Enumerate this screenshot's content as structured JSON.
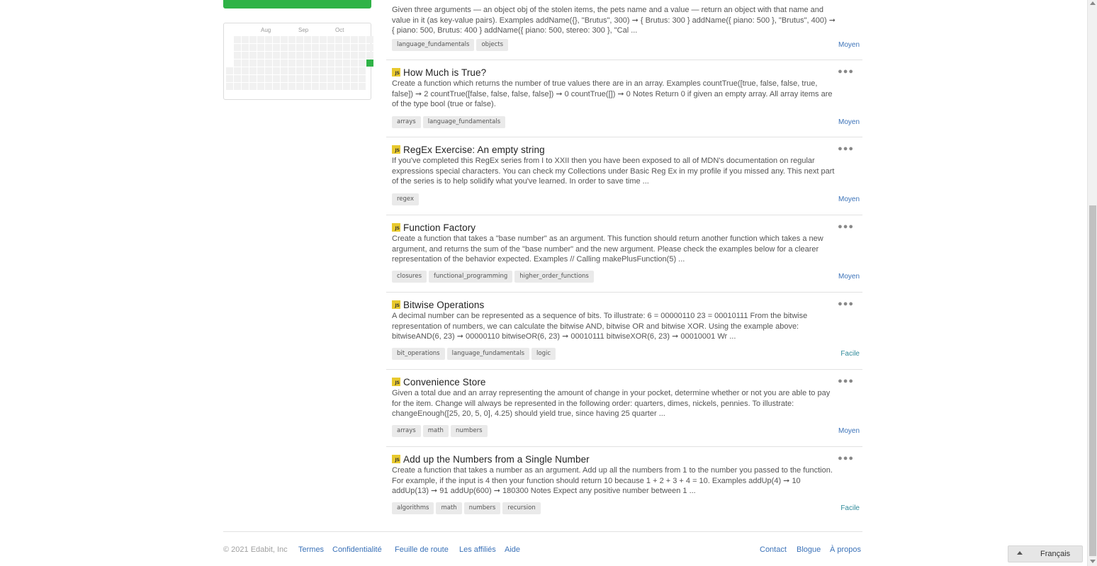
{
  "sidebar": {
    "heatmap": {
      "months": [
        "Aug",
        "Sep",
        "Oct"
      ],
      "colors": {
        "empty": "#f1f1f1",
        "active": "#2fb347"
      }
    }
  },
  "challenges": [
    {
      "title": "",
      "description": "Given three arguments — an object obj of the stolen items, the pets name and a value — return an object with that name and value in it (as key-value pairs). Examples addName({}, \"Brutus\", 300) ➞ { Brutus: 300 } addName({ piano: 500 }, \"Brutus\", 400) ➞ { piano: 500, Brutus: 400 } addName({ piano: 500, stereo: 300 }, \"Cal ...",
      "tags": [
        "language_fundamentals",
        "objects"
      ],
      "level": "Moyen"
    },
    {
      "title": "How Much is True?",
      "description": "Create a function which returns the number of true values there are in an array. Examples countTrue([true, false, false, true, false]) ➞ 2 countTrue([false, false, false, false]) ➞ 0 countTrue([]) ➞ 0 Notes Return 0 if given an empty array. All array items are of the type bool (true or false).",
      "tags": [
        "arrays",
        "language_fundamentals"
      ],
      "level": "Moyen"
    },
    {
      "title": "RegEx Exercise: An empty string",
      "description": "If you've completed this RegEx series from I to XXII then you have been exposed to all of MDN's documentation on regular expressions special characters. You can check my Collections under Basic Reg Ex in my profile if you missed any. This next part of the series is to help solidify what you've learned. In order to save time ...",
      "tags": [
        "regex"
      ],
      "level": "Moyen"
    },
    {
      "title": "Function Factory",
      "description": "Create a function that takes a \"base number\" as an argument. This function should return another function which takes a new argument, and returns the sum of the \"base number\" and the new argument. Please check the examples below for a clearer representation of the behavior expected. Examples // Calling makePlusFunction(5) ...",
      "tags": [
        "closures",
        "functional_programming",
        "higher_order_functions"
      ],
      "level": "Moyen"
    },
    {
      "title": "Bitwise Operations",
      "description": "A decimal number can be represented as a sequence of bits. To illustrate: 6 = 00000110 23 = 00010111 From the bitwise representation of numbers, we can calculate the bitwise AND, bitwise OR and bitwise XOR. Using the example above: bitwiseAND(6, 23) ➞ 00000110 bitwiseOR(6, 23) ➞ 00010111 bitwiseXOR(6, 23) ➞ 00010001 Wr ...",
      "tags": [
        "bit_operations",
        "language_fundamentals",
        "logic"
      ],
      "level": "Facile"
    },
    {
      "title": "Convenience Store",
      "description": "Given a total due and an array representing the amount of change in your pocket, determine whether or not you are able to pay for the item. Change will always be represented in the following order: quarters, dimes, nickels, pennies. To illustrate: changeEnough([25, 20, 5, 0], 4.25) should yield true, since having 25 quarter ...",
      "tags": [
        "arrays",
        "math",
        "numbers"
      ],
      "level": "Moyen"
    },
    {
      "title": "Add up the Numbers from a Single Number",
      "description": "Create a function that takes a number as an argument. Add up all the numbers from 1 to the number you passed to the function. For example, if the input is 4 then your function should return 10 because 1 + 2 + 3 + 4 = 10. Examples addUp(4) ➞ 10 addUp(13) ➞ 91 addUp(600) ➞ 180300 Notes Expect any positive number between 1 ...",
      "tags": [
        "algorithms",
        "math",
        "numbers",
        "recursion"
      ],
      "level": "Facile"
    }
  ],
  "footer": {
    "copyright": "© 2021 Edabit, Inc",
    "left_links": [
      "Termes",
      "Confidentialité",
      "Feuille de route",
      "Les affiliés",
      "Aide"
    ],
    "right_links": [
      "Contact",
      "Blogue",
      "À propos"
    ]
  },
  "language": {
    "label": "Français"
  },
  "badge_text": "JS",
  "more_icon": "more-horizontal-icon",
  "colors": {
    "accent_green": "#2fb347",
    "link_blue": "#3b72b8",
    "easy_teal": "#2f8a9a",
    "js_yellow": "#e8c92e"
  }
}
